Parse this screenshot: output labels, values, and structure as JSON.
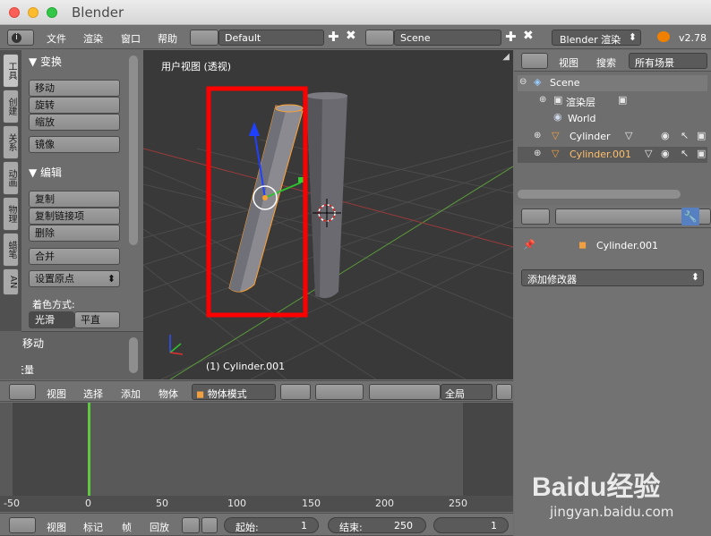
{
  "window": {
    "title": "Blender"
  },
  "topbar": {
    "menus": [
      "文件",
      "渲染",
      "窗口",
      "帮助"
    ],
    "layout_name": "Default",
    "scene_name": "Scene",
    "render_engine": "Blender 渲染",
    "version": "v2.78"
  },
  "tool_tabs": [
    "工具",
    "创建",
    "关系",
    "动画",
    "物理",
    "蜡笔",
    "AN"
  ],
  "tool_shelf": {
    "transform_header": "▼ 变换",
    "transform_buttons": [
      "移动",
      "旋转",
      "缩放"
    ],
    "mirror": "镜像",
    "edit_header": "▼ 编辑",
    "edit_buttons": [
      "复制",
      "复制链接项",
      "删除"
    ],
    "join": "合并",
    "set_origin": "设置原点",
    "shading_label": "着色方式:",
    "smooth": "光滑",
    "flat": "平直",
    "move_header": "▼ 移动",
    "vector_label": "矢量"
  },
  "viewport": {
    "view_label": "用户视图 (透视)",
    "object_label": "(1) Cylinder.001",
    "header": {
      "menus": [
        "视图",
        "选择",
        "添加",
        "物体"
      ],
      "mode": "物体模式",
      "pivot": "全局"
    }
  },
  "outliner": {
    "menus": [
      "视图",
      "搜索"
    ],
    "filter": "所有场景",
    "items": [
      {
        "label": "Scene"
      },
      {
        "label": "渲染层"
      },
      {
        "label": "World"
      },
      {
        "label": "Cylinder"
      },
      {
        "label": "Cylinder.001"
      }
    ]
  },
  "properties": {
    "object_name": "Cylinder.001",
    "add_modifier": "添加修改器"
  },
  "timeline": {
    "ruler": [
      "-50",
      "0",
      "50",
      "100",
      "150",
      "200",
      "250"
    ],
    "menus": [
      "视图",
      "标记",
      "帧",
      "回放"
    ],
    "start_label": "起始:",
    "start_value": "1",
    "end_label": "结束:",
    "end_value": "250",
    "current_frame": "1"
  },
  "watermark": {
    "brand": "Baidu经验",
    "url": "jingyan.baidu.com"
  },
  "colors": {
    "selection_box": "#ff0000",
    "active_object": "#ffa030",
    "frame_marker": "#60c840"
  }
}
